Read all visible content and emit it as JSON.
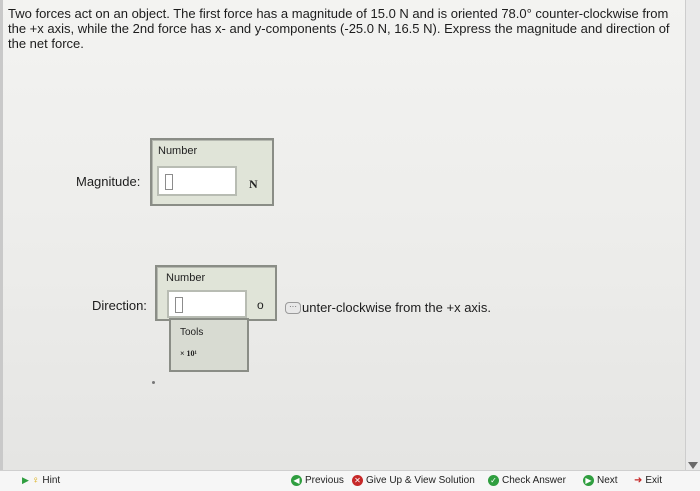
{
  "question": "Two forces act on an object. The first force has a magnitude of 15.0 N and is oriented 78.0° counter-clockwise from the +x axis, while the 2nd force has x- and y-components (-25.0 N, 16.5 N). Express the magnitude and direction of the net force.",
  "magnitude": {
    "caption": "Number",
    "label": "Magnitude:",
    "value": "",
    "unit": "N"
  },
  "direction": {
    "caption": "Number",
    "label": "Direction:",
    "value": "",
    "degree_symbol": "o",
    "suffix": "unter-clockwise from the +x axis.",
    "tools_label": "Tools",
    "sci_notation": "× 10¹"
  },
  "toolbar": {
    "hint": "Hint",
    "previous": "Previous",
    "give_up": "Give Up & View Solution",
    "check": "Check Answer",
    "next": "Next",
    "exit": "Exit"
  },
  "colors": {
    "panel_bg": "#e0e4d8",
    "panel_border": "#8a8d86",
    "previous_icon": "#2f9e3f",
    "giveup_icon": "#c62828",
    "check_icon": "#2f9e3f",
    "next_icon": "#2f9e3f",
    "exit_icon": "#c62828"
  }
}
